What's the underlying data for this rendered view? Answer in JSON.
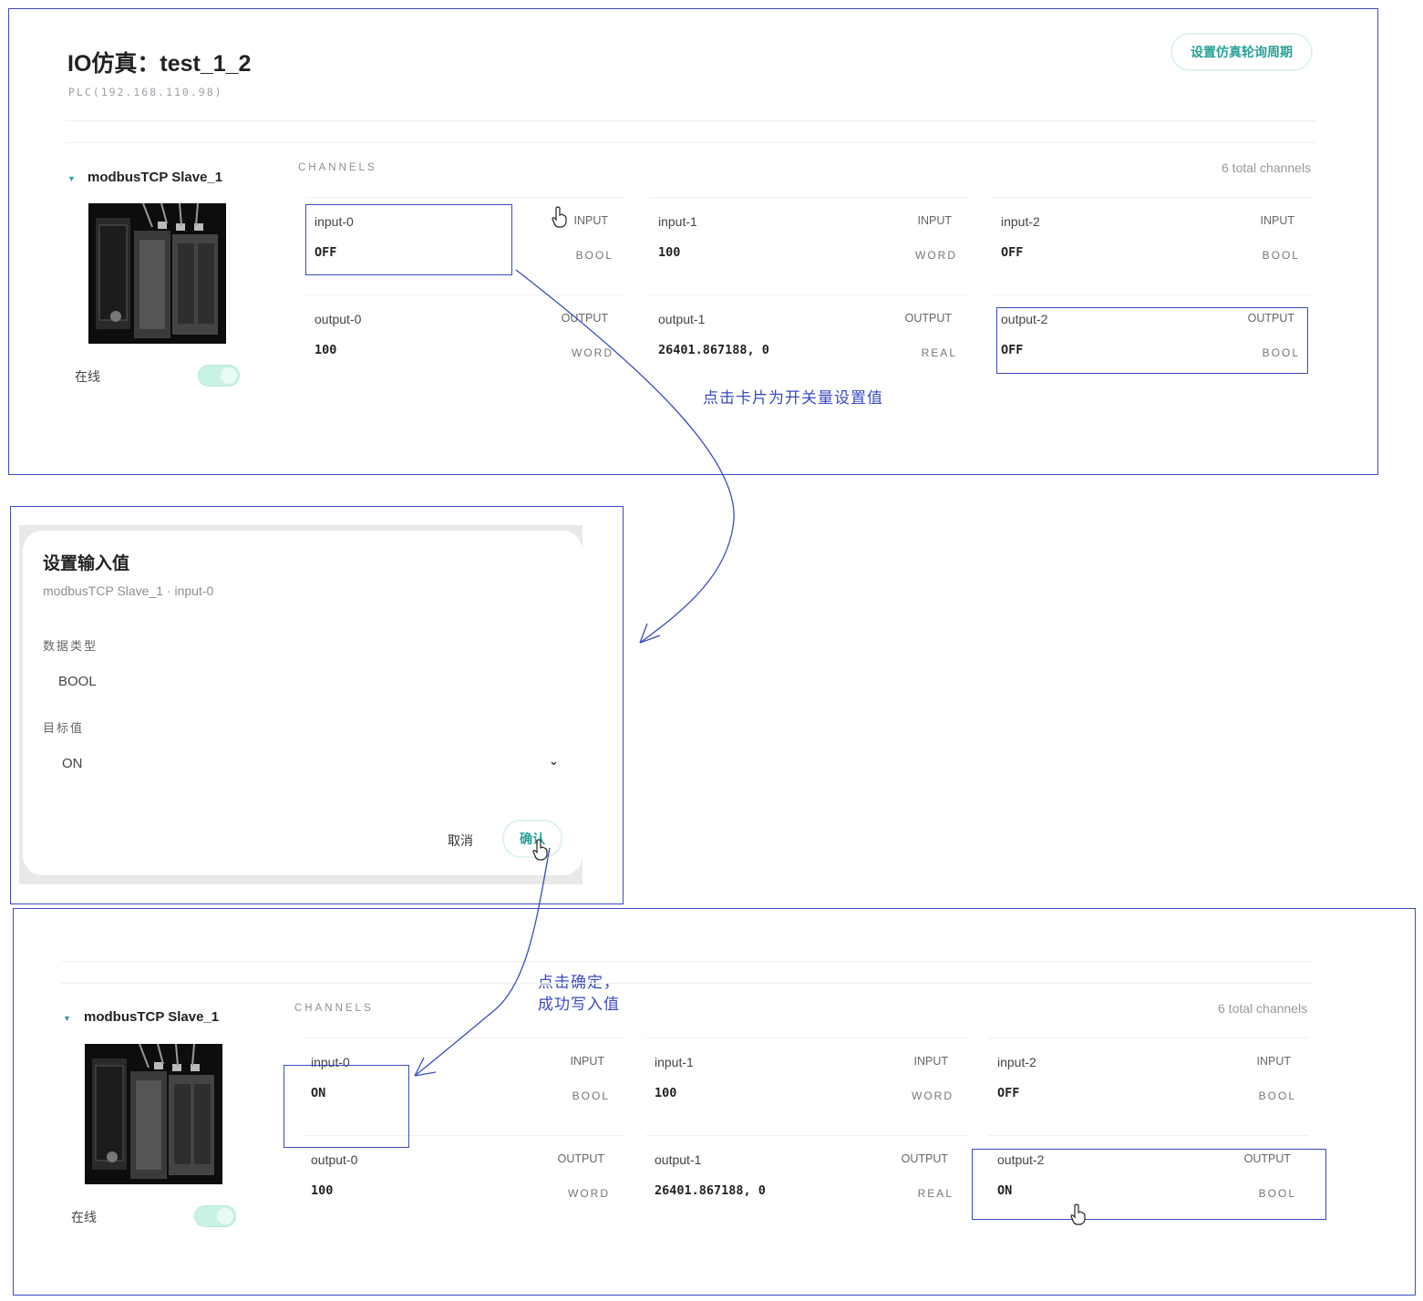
{
  "top": {
    "title": "IO仿真：test_1_2",
    "subtitle": "PLC(192.168.110.98)",
    "poll_button": "设置仿真轮询周期",
    "device": {
      "name": "modbusTCP Slave_1",
      "status_label": "在线",
      "online": true
    },
    "channels_header": "CHANNELS",
    "total": "6 total channels",
    "cards": [
      {
        "name": "input-0",
        "dir": "INPUT",
        "value": "OFF",
        "type": "BOOL"
      },
      {
        "name": "input-1",
        "dir": "INPUT",
        "value": "100",
        "type": "WORD"
      },
      {
        "name": "input-2",
        "dir": "INPUT",
        "value": "OFF",
        "type": "BOOL"
      },
      {
        "name": "output-0",
        "dir": "OUTPUT",
        "value": "100",
        "type": "WORD"
      },
      {
        "name": "output-1",
        "dir": "OUTPUT",
        "value": "26401.867188, 0",
        "type": "REAL"
      },
      {
        "name": "output-2",
        "dir": "OUTPUT",
        "value": "OFF",
        "type": "BOOL"
      }
    ]
  },
  "annotation_1": "点击卡片为开关量设置值",
  "dialog": {
    "title": "设置输入值",
    "subtitle": "modbusTCP Slave_1 · input-0",
    "type_label": "数据类型",
    "type_value": "BOOL",
    "target_label": "目标值",
    "target_value": "ON",
    "cancel": "取消",
    "confirm": "确认"
  },
  "annotation_2_line1": "点击确定，",
  "annotation_2_line2": "成功写入值",
  "bottom": {
    "device": {
      "name": "modbusTCP Slave_1",
      "status_label": "在线",
      "online": true
    },
    "channels_header": "CHANNELS",
    "total": "6 total channels",
    "cards": [
      {
        "name": "input-0",
        "dir": "INPUT",
        "value": "ON",
        "type": "BOOL"
      },
      {
        "name": "input-1",
        "dir": "INPUT",
        "value": "100",
        "type": "WORD"
      },
      {
        "name": "input-2",
        "dir": "INPUT",
        "value": "OFF",
        "type": "BOOL"
      },
      {
        "name": "output-0",
        "dir": "OUTPUT",
        "value": "100",
        "type": "WORD"
      },
      {
        "name": "output-1",
        "dir": "OUTPUT",
        "value": "26401.867188, 0",
        "type": "REAL"
      },
      {
        "name": "output-2",
        "dir": "OUTPUT",
        "value": "ON",
        "type": "BOOL"
      }
    ]
  },
  "colors": {
    "accent": "#2aa198",
    "annotation": "#3a4bc4",
    "toggle_on": "#c9f2e6"
  },
  "icons": [
    "caret-down-icon",
    "chevron-down-icon",
    "hand-cursor-icon",
    "device-photo"
  ]
}
